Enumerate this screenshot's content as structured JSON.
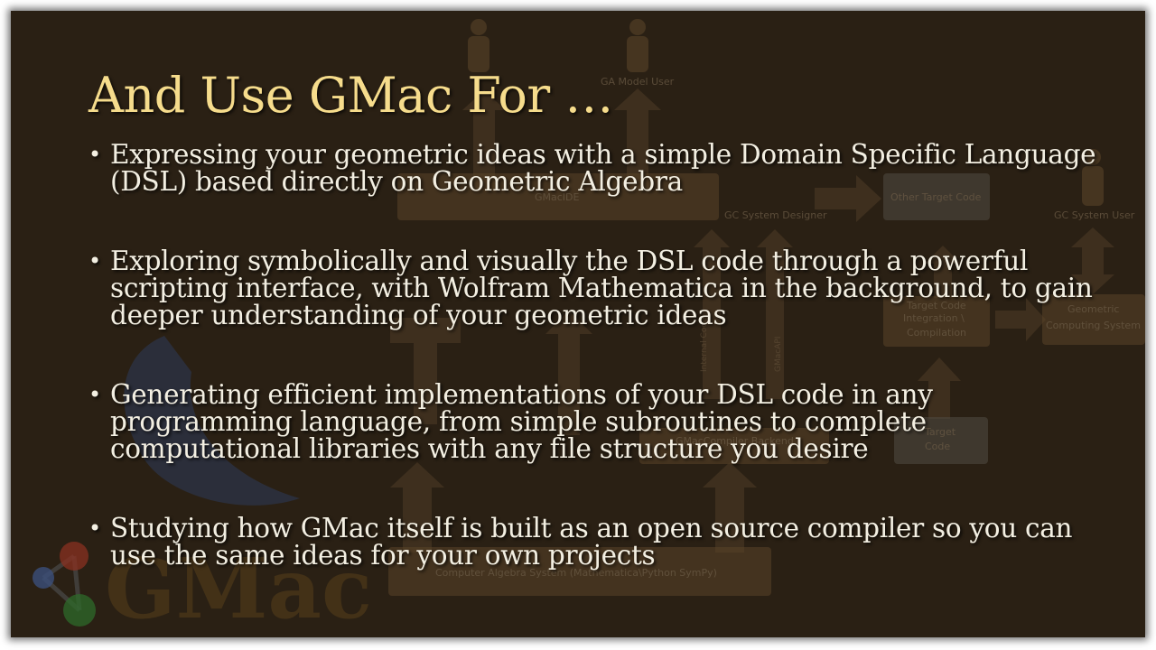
{
  "slide": {
    "title": "And Use GMac For …",
    "bullets": [
      "Expressing your geometric ideas with a simple Domain Specific Language (DSL) based directly on Geometric Algebra",
      "Exploring symbolically and visually the DSL code through a powerful scripting interface, with Wolfram Mathematica in the background, to gain deeper understanding of your geometric ideas",
      "Generating efficient implementations of your DSL code in any programming language, from simple subroutines to complete computational libraries with any file structure you desire",
      "Studying how GMac itself is built as an open source compiler so you can use the same ideas for your own projects"
    ],
    "bullet_glyph": "•"
  },
  "background_diagram": {
    "labels": {
      "ga_model_user": "GA Model User",
      "gmacide": "GMacIDE",
      "other_target_code": "Other Target Code",
      "gc_system_designer": "GC System Designer",
      "gc_system_user": "GC System User",
      "target_code_integration": "Target Code Integration \\ Compilation",
      "geometric_computing_system": "Geometric Computing System",
      "gmac_compiler_backend": "GMacCompiler Backend",
      "target_code": "Target Code",
      "cas": "Computer Algebra System (Mathematica\\Python SymPy)",
      "logo": "GMac"
    }
  },
  "colors": {
    "slide_bg": "#2a2014",
    "title": "#f6dc8c",
    "body_text": "#f3efe2"
  }
}
